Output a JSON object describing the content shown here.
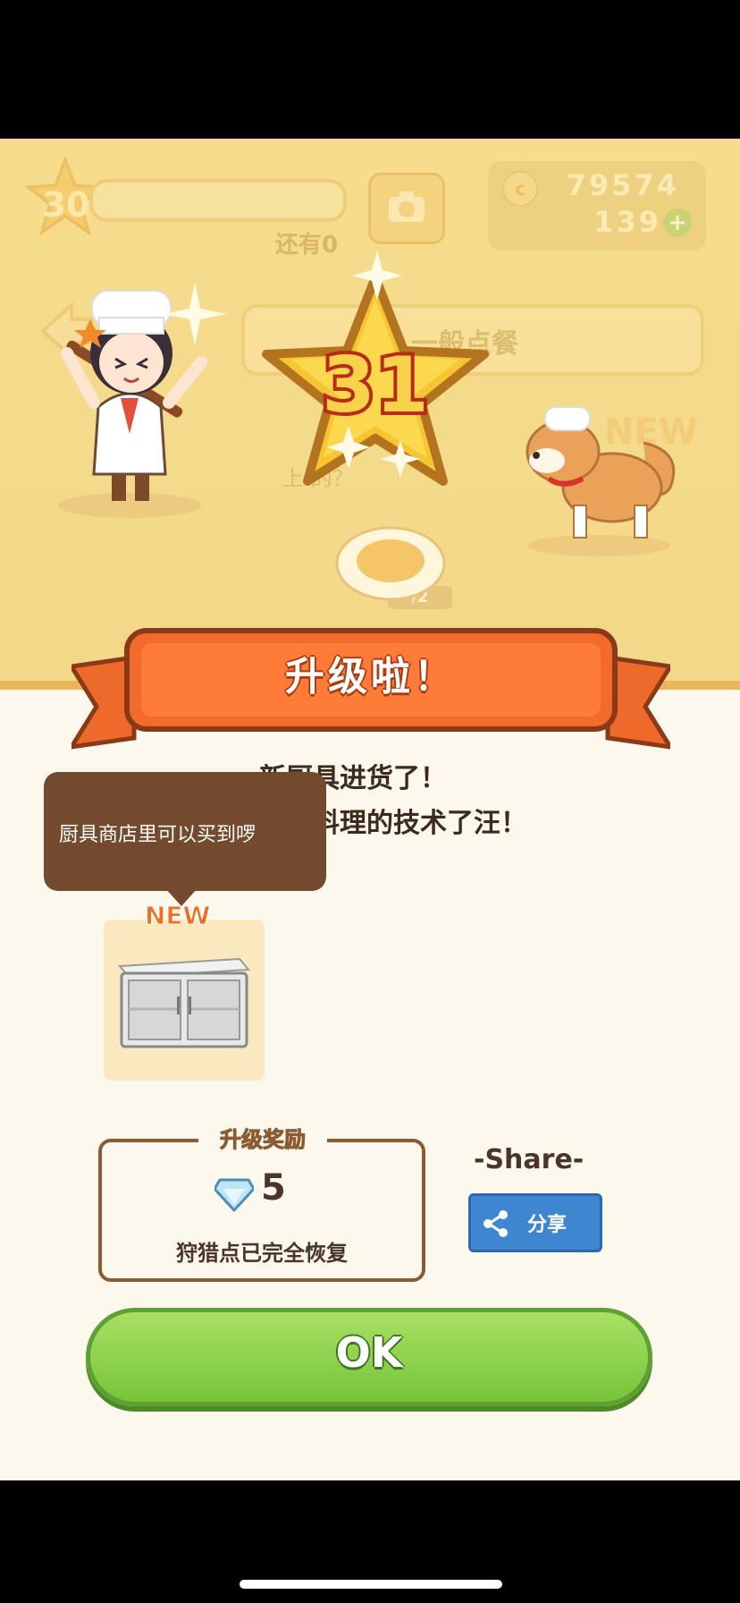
{
  "hud": {
    "level": "30",
    "xp_remaining": "还有0",
    "coins": "79574",
    "gems": "139",
    "order_mode": "一般点餐",
    "question": "上    的？",
    "dish_count": "/2",
    "new_badge_bg": "NEW"
  },
  "level_up": {
    "new_level": "31",
    "title": "升级啦！",
    "message_line1": "新厨具进货了！",
    "message_line2": "…煎烤料理的技术了汪！",
    "tooltip": "厨具商店里可以买到啰",
    "new_tag": "NEW",
    "item_icon": "display-cabinet-icon"
  },
  "reward": {
    "label": "升级奖励",
    "gem_amount": "5",
    "description": "狩猎点已完全恢复"
  },
  "share": {
    "title": "-Share-",
    "button_label": "分享"
  },
  "ok_button": "OK",
  "colors": {
    "ribbon": "#f26b2c",
    "ok_green": "#86cf48",
    "share_blue": "#3f86d0",
    "star_gold": "#f6c531"
  }
}
